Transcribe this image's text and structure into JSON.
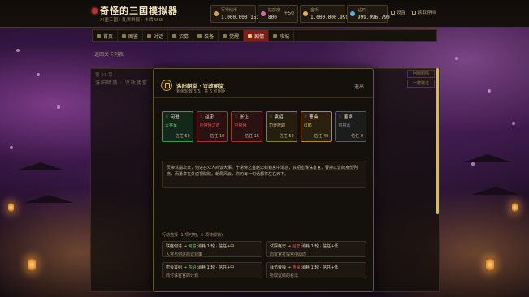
{
  "app": {
    "title": "奇怪的三国模拟器",
    "subtitle": "水墨三国 · 乱世群殿 · 卡牌RPG"
  },
  "header": {
    "stats": [
      {
        "label": "军需储币",
        "value": "1,000,000,153",
        "color": "#d9a74a",
        "plus": ""
      },
      {
        "label": "好感度",
        "value": "800",
        "color": "#d36b9b",
        "plus": "+50"
      },
      {
        "label": "金币",
        "value": "1,000,000,999",
        "color": "#e2b84a",
        "plus": ""
      },
      {
        "label": "钻石",
        "value": "999,996,799",
        "color": "#5ab0e8",
        "plus": ""
      }
    ],
    "settings_label": "设置",
    "archive_label": "读取存档"
  },
  "nav": {
    "items": [
      {
        "label": "首页",
        "icon": "home-icon"
      },
      {
        "label": "图鉴",
        "icon": "book-icon"
      },
      {
        "label": "对话",
        "icon": "chat-icon"
      },
      {
        "label": "招募",
        "icon": "recruit-icon"
      },
      {
        "label": "装备",
        "icon": "equip-icon"
      },
      {
        "label": "觉醒",
        "icon": "star-icon"
      },
      {
        "label": "剧情",
        "icon": "scroll-icon",
        "active": true
      },
      {
        "label": "攻城",
        "icon": "castle-icon"
      }
    ]
  },
  "background_panel": {
    "back_link": "返回关卡列表",
    "episode_no": "第 01 章",
    "episode_title": "洛阳暗潮 · 议政朝堂",
    "btn_history": "回顾剧情",
    "btn_skip": "一键跳过"
  },
  "modal": {
    "title": "洛阳朝堂 · 议政朝堂",
    "subtitle": "剩余轮数 5/5 · 共 6 位朝臣",
    "exit_label": "退出",
    "roles": [
      {
        "name": "何进",
        "status": "大将军",
        "favor": "信任 60",
        "border": "#3f9a4b",
        "bg": "#13271a",
        "status_color": "#6fd46f"
      },
      {
        "name": "赵忠",
        "status": "中常侍之首",
        "favor": "信任 10",
        "border": "#a03434",
        "bg": "#2a1212",
        "status_color": "#e45a5a"
      },
      {
        "name": "张让",
        "status": "中常侍",
        "favor": "信任 15",
        "border": "#a03434",
        "bg": "#2a1212",
        "status_color": "#e45a5a"
      },
      {
        "name": "袁绍",
        "status": "司隶校尉",
        "favor": "信任 50",
        "border": "#8d7a3f",
        "bg": "#241e10",
        "status_color": "#c9b07a"
      },
      {
        "name": "曹操",
        "status": "议郎",
        "favor": "信任 40",
        "border": "#b38a2e",
        "bg": "#2a2010",
        "status_color": "#e2b84a"
      },
      {
        "name": "董卓",
        "status": "前将军",
        "favor": "信任 0",
        "border": "#5a5a5a",
        "bg": "#1c1c1c",
        "status_color": "#9a9a9a"
      }
    ],
    "story": "灵帝驾崩次日，何进召众人商议大事。十常侍之首赵忠封锁宫中消息，袁绍密谋诛宦官，曹操以议郎身份列席，而董卓在外虎视眈眈。朝局风云，你的每一句话都将左右天下。",
    "actions_title": "行动选择 (1 项可用，5 项待解锁)",
    "actions": [
      {
        "line1_pre": "联络何进 → ",
        "line1_mid": "何进",
        "line1_post": " 消耗 1 轮 · 信任+中",
        "mid_ok": true,
        "line2": "入宫与何进商议对策"
      },
      {
        "line1_pre": "试探赵忠 → ",
        "line1_mid": "赵忠",
        "line1_post": " 消耗 1 轮 · 信任+低",
        "mid_ok": false,
        "line2": "向宦官打探宫中动向"
      },
      {
        "line1_pre": "密会袁绍 → ",
        "line1_mid": "袁绍",
        "line1_post": " 消耗 1 轮 · 信任+中",
        "mid_ok": true,
        "line2": "商讨诛宦官的计划"
      },
      {
        "line1_pre": "拜访曹操 → ",
        "line1_mid": "曹操",
        "line1_post": " 消耗 1 轮 · 信任+低",
        "mid_ok": false,
        "line2": "听取议郎的看法"
      }
    ]
  }
}
